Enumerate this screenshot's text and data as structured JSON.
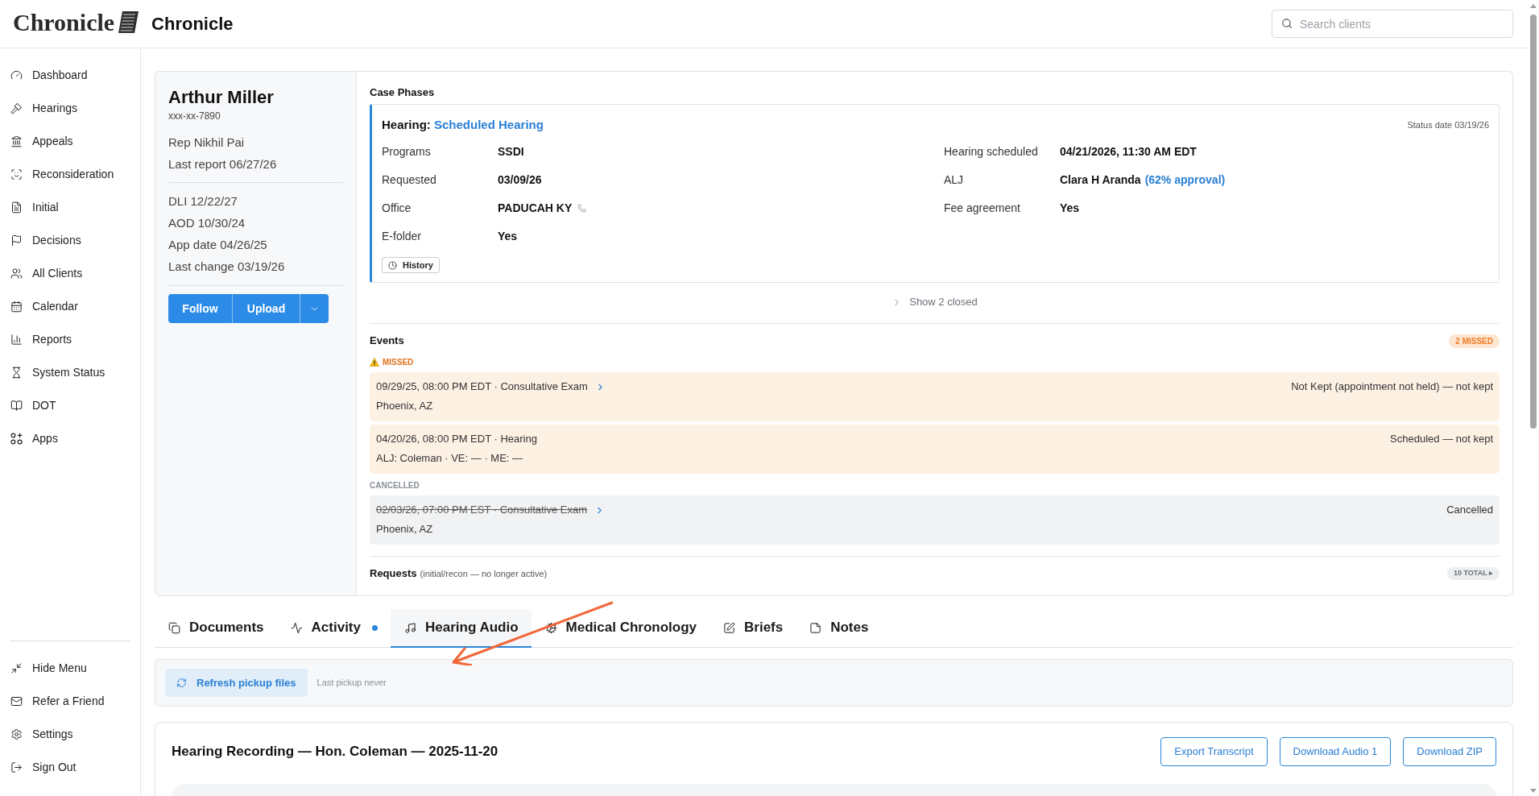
{
  "header": {
    "logo": "Chronicle",
    "title": "Chronicle",
    "search": {
      "placeholder": "Search clients"
    }
  },
  "sidebar": {
    "items": [
      "Dashboard",
      "Hearings",
      "Appeals",
      "Reconsideration",
      "Initial",
      "Decisions",
      "All Clients",
      "Calendar",
      "Reports",
      "System Status",
      "DOT",
      "Apps"
    ],
    "footer_items": [
      "Hide Menu",
      "Refer a Friend",
      "Settings",
      "Sign Out"
    ]
  },
  "client": {
    "name": "Arthur Miller",
    "ssn": "xxx-xx-7890",
    "details_1": [
      "Rep Nikhil Pai",
      "Last report 06/27/26"
    ],
    "details_2": [
      "DLI 12/22/27",
      "AOD 10/30/24",
      "App date 04/26/25",
      "Last change 03/19/26"
    ],
    "buttons": [
      "Follow",
      "Upload"
    ]
  },
  "case_phases": {
    "title": "Case Phases",
    "phase": {
      "label": "Hearing:",
      "status": "Scheduled Hearing",
      "status_date": "Status date 03/19/26",
      "fields_left": [
        {
          "kind": "plain",
          "label": "Programs",
          "value": "SSDI"
        },
        {
          "kind": "plain",
          "label": "Requested",
          "value": "03/09/26"
        },
        {
          "kind": "phone",
          "label": "Office",
          "value": "PADUCAH KY"
        },
        {
          "kind": "plain",
          "label": "E-folder",
          "value": "Yes"
        }
      ],
      "fields_right": [
        {
          "kind": "plain",
          "label": "Hearing scheduled",
          "value": "04/21/2026, 11:30 AM EDT"
        },
        {
          "kind": "rated",
          "label": "ALJ",
          "value": "Clara H Aranda",
          "note": "(62% approval)"
        },
        {
          "kind": "plain",
          "label": "Fee agreement",
          "value": "Yes"
        }
      ],
      "history_button": "History"
    },
    "show_closed": "Show 2 closed"
  },
  "events": {
    "title": "Events",
    "badge": "2 MISSED",
    "groups": [
      {
        "kind": "missed",
        "label": "MISSED",
        "items": [
          {
            "when": "09/29/25, 08:00 PM EDT · Consultative Exam",
            "detail": "Phoenix, AZ",
            "status": "Not Kept (appointment not held) — not kept",
            "has_link": true
          },
          {
            "when": "04/20/26, 08:00 PM EDT · Hearing",
            "detail": "ALJ: Coleman · VE: — · ME: —",
            "status": "Scheduled — not kept",
            "has_link": false
          }
        ]
      },
      {
        "kind": "cancelled",
        "label": "CANCELLED",
        "items": [
          {
            "when": "02/03/26, 07:00 PM EST · Consultative Exam",
            "detail": "Phoenix, AZ",
            "status": "Cancelled",
            "has_link": true
          }
        ]
      }
    ]
  },
  "requests": {
    "title": "Requests",
    "note": "(initial/recon — no longer active)",
    "badge": "10 TOTAL ▸"
  },
  "tabs": [
    {
      "label": "Documents",
      "selected": false,
      "dot": false
    },
    {
      "label": "Activity",
      "selected": false,
      "dot": true
    },
    {
      "label": "Hearing Audio",
      "selected": true,
      "dot": false
    },
    {
      "label": "Medical Chronology",
      "selected": false,
      "dot": false
    },
    {
      "label": "Briefs",
      "selected": false,
      "dot": false
    },
    {
      "label": "Notes",
      "selected": false,
      "dot": false
    }
  ],
  "pickup": {
    "button": "Refresh pickup files",
    "note": "Last pickup never"
  },
  "recording": {
    "title": "Hearing Recording — Hon. Coleman — 2025-11-20",
    "buttons": [
      "Export Transcript",
      "Download Audio 1",
      "Download ZIP"
    ]
  }
}
